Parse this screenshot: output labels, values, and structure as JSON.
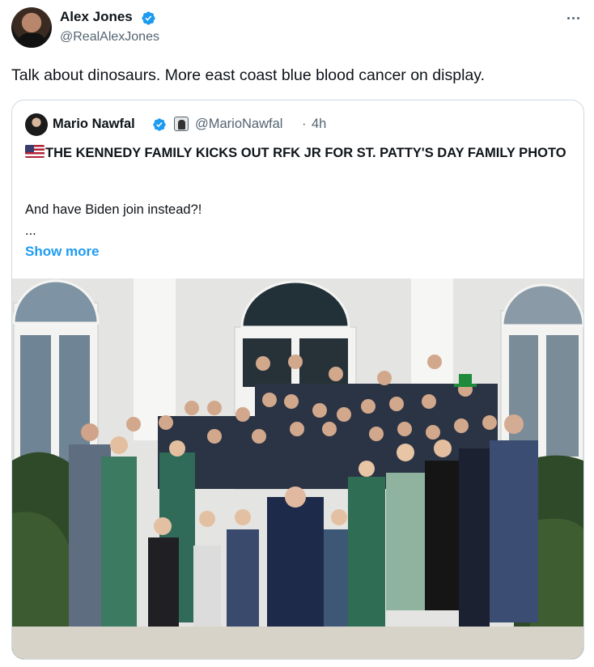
{
  "post": {
    "author_name": "Alex Jones",
    "author_handle": "@RealAlexJones",
    "text": "Talk about dinosaurs. More east coast blue blood cancer on display."
  },
  "quoted": {
    "author_name": "Mario Nawfal",
    "author_handle": "@MarioNawfal",
    "separator": "·",
    "time": "4h",
    "headline": "THE KENNEDY FAMILY KICKS OUT RFK JR FOR ST. PATTY'S DAY FAMILY PHOTO",
    "body": "And have Biden join instead?!",
    "ellipsis": "...",
    "show_more": "Show more"
  },
  "icons": {
    "verified": "verified-badge-icon",
    "more": "more-options-icon",
    "flag": "us-flag-emoji",
    "affiliate": "affiliate-badge-icon"
  },
  "colors": {
    "text": "#0f1419",
    "secondary": "#536471",
    "link": "#1d9bf0",
    "border": "#cfd9de"
  }
}
